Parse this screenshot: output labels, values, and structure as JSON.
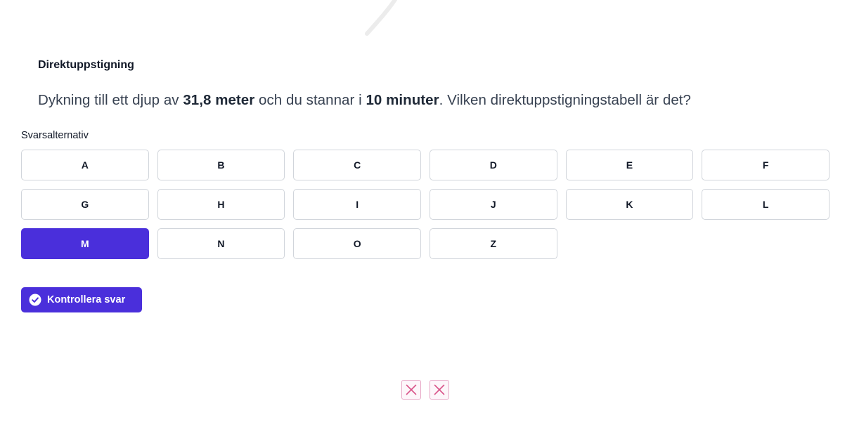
{
  "card": {
    "title": "Direktuppstigning"
  },
  "question": {
    "part1": "Dykning till ett djup av ",
    "depth": "31,8 meter",
    "part2": " och du stannar i ",
    "time": "10 minuter",
    "part3": ". Vilken direktuppstigningstabell är det?"
  },
  "answers": {
    "label": "Svarsalternativ",
    "options": [
      "A",
      "B",
      "C",
      "D",
      "E",
      "F",
      "G",
      "H",
      "I",
      "J",
      "K",
      "L",
      "M",
      "N",
      "O",
      "Z"
    ],
    "selected": "M"
  },
  "check_button": {
    "label": "Kontrollera svar",
    "icon": "check-circle-icon"
  },
  "status_marks": [
    {
      "icon": "x-icon",
      "state": "wrong"
    },
    {
      "icon": "x-icon",
      "state": "wrong"
    }
  ],
  "colors": {
    "accent": "#4a2fdb",
    "border": "#d1d5db",
    "wrong_mark": "#d9558a"
  }
}
